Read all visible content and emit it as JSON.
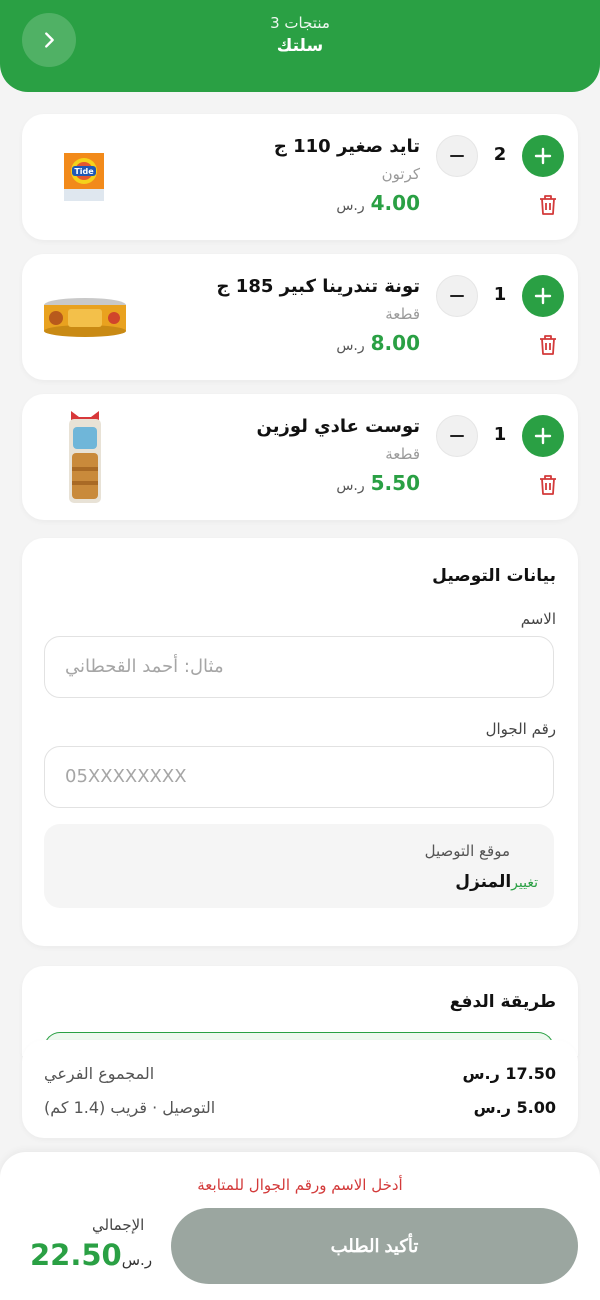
{
  "header": {
    "items_count": "3 منتجات",
    "title": "سلتك"
  },
  "cart": {
    "currency": "ر.س",
    "items": [
      {
        "name": "تايد صغير 110 ج",
        "unit": "كرتون",
        "price": "4.00",
        "qty": "2"
      },
      {
        "name": "تونة تندرينا كبير 185 ج",
        "unit": "قطعة",
        "price": "8.00",
        "qty": "1"
      },
      {
        "name": "توست عادي لوزين",
        "unit": "قطعة",
        "price": "5.50",
        "qty": "1"
      }
    ]
  },
  "delivery": {
    "title": "بيانات التوصيل",
    "name_label": "الاسم",
    "name_placeholder": "مثال: أحمد القحطاني",
    "phone_label": "رقم الجوال",
    "phone_placeholder": "05XXXXXXXX",
    "location_label": "موقع التوصيل",
    "location_value": "المنزل",
    "change_label": "تغيير"
  },
  "payment": {
    "title": "طريقة الدفع"
  },
  "summary": {
    "subtotal_label": "المجموع الفرعي",
    "subtotal_value": "17.50 ر.س",
    "delivery_label": "التوصيل · قريب (1.4 كم)",
    "delivery_value": "5.00 ر.س"
  },
  "footer": {
    "warning": "أدخل الاسم ورقم الجوال للمتابعة",
    "total_label": "الإجمالي",
    "total_value": "22.50",
    "total_currency": "ر.س",
    "confirm_label": "تأكيد الطلب"
  },
  "colors": {
    "primary": "#2aa044",
    "danger": "#d33a3a",
    "disabled_button": "#9ba6a0"
  }
}
